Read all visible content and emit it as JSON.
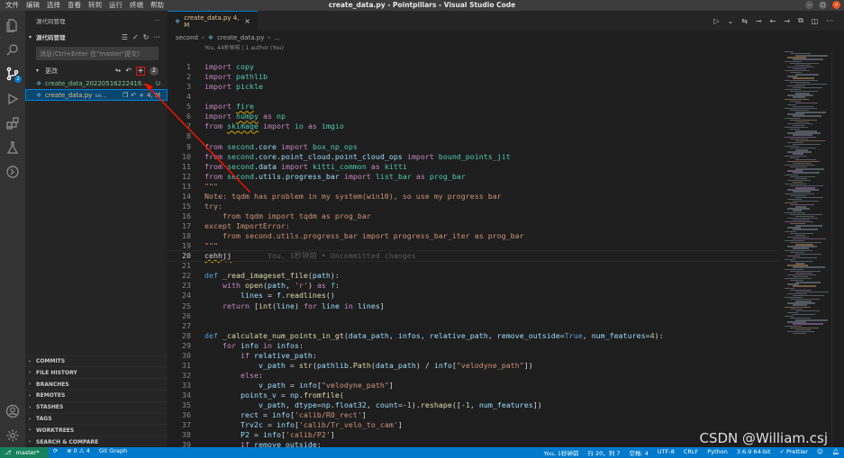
{
  "titlebar": {
    "menu": [
      "文件",
      "编辑",
      "选择",
      "查看",
      "转到",
      "运行",
      "终端",
      "帮助"
    ],
    "title": "create_data.py - Pointpillars - Visual Studio Code"
  },
  "activity": {
    "items": [
      "explorer-icon",
      "search-icon",
      "source-control-icon",
      "run-debug-icon",
      "extensions-icon",
      "testing-icon",
      "remote-icon",
      "account-icon",
      "settings-icon"
    ],
    "scm_badge": "2"
  },
  "sidebar": {
    "header": "源代码管理",
    "header_more": "···",
    "section_title": "源代码管理",
    "message_placeholder": "消息(Ctrl+Enter 在\"master\"提交)",
    "changes_label": "更改",
    "changes_count": "2",
    "files": [
      {
        "name": "create_data_20220516222416...",
        "status": "U"
      },
      {
        "name": "create_data.py",
        "path": "se...",
        "status": "4, M"
      }
    ],
    "bottom_sections": [
      "COMMITS",
      "FILE HISTORY",
      "BRANCHES",
      "REMOTES",
      "STASHES",
      "TAGS",
      "WORKTREES",
      "SEARCH & COMPARE"
    ]
  },
  "editor": {
    "tab_label": "create_data.py 4, M",
    "breadcrumb": [
      "second",
      "create_data.py",
      "..."
    ],
    "blame_header": "You, 44秒钟前 | 1 author (You)",
    "inline_blame": "You, 1秒钟前 • Uncommitted changes"
  },
  "code_lines": [
    {
      "n": "1",
      "t": "import copy"
    },
    {
      "n": "2",
      "t": "import pathlib"
    },
    {
      "n": "3",
      "t": "import pickle"
    },
    {
      "n": "4",
      "t": ""
    },
    {
      "n": "5",
      "t": "import fire"
    },
    {
      "n": "6",
      "t": "import numpy as np"
    },
    {
      "n": "7",
      "t": "from skimage import io as imgio"
    },
    {
      "n": "8",
      "t": ""
    },
    {
      "n": "9",
      "t": "from second.core import box_np_ops"
    },
    {
      "n": "10",
      "t": "from second.core.point_cloud.point_cloud_ops import bound_points_jit"
    },
    {
      "n": "11",
      "t": "from second.data import kitti_common as kitti"
    },
    {
      "n": "12",
      "t": "from second.utils.progress_bar import list_bar as prog_bar"
    },
    {
      "n": "13",
      "t": "\"\"\""
    },
    {
      "n": "14",
      "t": "Note: tqdm has problem in my system(win10), so use my progress bar"
    },
    {
      "n": "15",
      "t": "try:"
    },
    {
      "n": "16",
      "t": "    from tqdm import tqdm as prog_bar"
    },
    {
      "n": "17",
      "t": "except ImportError:"
    },
    {
      "n": "18",
      "t": "    from second.utils.progress_bar import progress_bar_iter as prog_bar"
    },
    {
      "n": "19",
      "t": "\"\"\""
    },
    {
      "n": "20",
      "t": "cehhjj"
    },
    {
      "n": "21",
      "t": ""
    },
    {
      "n": "22",
      "t": "def _read_imageset_file(path):"
    },
    {
      "n": "23",
      "t": "    with open(path, 'r') as f:"
    },
    {
      "n": "24",
      "t": "        lines = f.readlines()"
    },
    {
      "n": "25",
      "t": "    return [int(line) for line in lines]"
    },
    {
      "n": "26",
      "t": ""
    },
    {
      "n": "27",
      "t": ""
    },
    {
      "n": "28",
      "t": "def _calculate_num_points_in_gt(data_path, infos, relative_path, remove_outside=True, num_features=4):"
    },
    {
      "n": "29",
      "t": "    for info in infos:"
    },
    {
      "n": "30",
      "t": "        if relative_path:"
    },
    {
      "n": "31",
      "t": "            v_path = str(pathlib.Path(data_path) / info[\"velodyne_path\"])"
    },
    {
      "n": "32",
      "t": "        else:"
    },
    {
      "n": "33",
      "t": "            v_path = info[\"velodyne_path\"]"
    },
    {
      "n": "34",
      "t": "        points_v = np.fromfile("
    },
    {
      "n": "35",
      "t": "            v_path, dtype=np.float32, count=-1).reshape([-1, num_features])"
    },
    {
      "n": "36",
      "t": "        rect = info['calib/R0_rect']"
    },
    {
      "n": "37",
      "t": "        Trv2c = info['calib/Tr_velo_to_cam']"
    },
    {
      "n": "38",
      "t": "        P2 = info['calib/P2']"
    },
    {
      "n": "39",
      "t": "        if remove_outside:"
    }
  ],
  "statusbar": {
    "branch": "master*",
    "sync": "⟳",
    "problems": "⊗ 0 ⚠ 4",
    "git_graph": "Git Graph",
    "blame": "You, 1秒钟前",
    "position": "行 20，列 7",
    "indent": "空格: 4",
    "encoding": "UTF-8",
    "eol": "CRLF",
    "language": "Python",
    "interpreter": "3.6.9 64-bit",
    "prettier": "✓ Prettier"
  },
  "watermark": "CSDN @William.csj",
  "colors": {
    "accent": "#007acc",
    "annotation": "#e51400",
    "modified": "#e2c08d"
  }
}
